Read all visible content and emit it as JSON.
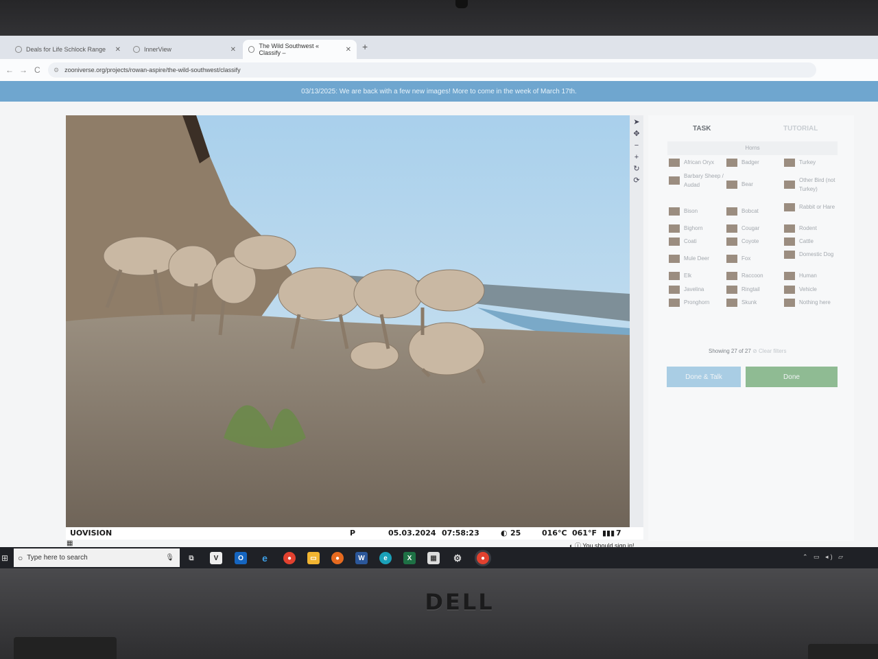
{
  "browser": {
    "tabs": [
      {
        "label": "Deals for Life Schlock Range"
      },
      {
        "label": "InnerView"
      },
      {
        "label": "The Wild Southwest « Classify –"
      }
    ],
    "new_tab": "+",
    "url": "zooniverse.org/projects/rowan-aspire/the-wild-southwest/classify",
    "back": "←",
    "forward": "→",
    "reload": "C"
  },
  "banner": {
    "text": "03/13/2025: We are back with a few new images! More to come in the week of March 17th."
  },
  "subject": {
    "camera_brand": "UOVISION",
    "mode": "P",
    "date": "05.03.2024",
    "time": "07:58:23",
    "moon_value": "25",
    "temp_c": "016°C",
    "temp_f": "061°F",
    "battery": "7"
  },
  "tools": [
    "➤",
    "✥",
    "−",
    "+",
    "↻",
    "⟳"
  ],
  "panel": {
    "tab_task": "TASK",
    "tab_tutorial": "TUTORIAL",
    "filters_label": "Horns",
    "choices": [
      [
        "African Oryx",
        "Badger",
        "Turkey"
      ],
      [
        "Barbary Sheep / Audad",
        "Bear",
        "Other Bird (not Turkey)"
      ],
      [
        "Bison",
        "Bobcat",
        "Rabbit or Hare"
      ],
      [
        "Bighorn",
        "Cougar",
        "Rodent"
      ],
      [
        "Coati",
        "Coyote",
        "Cattle"
      ],
      [
        "Mule Deer",
        "Fox",
        "Domestic Dog"
      ],
      [
        "Elk",
        "Raccoon",
        "Human"
      ],
      [
        "Javelina",
        "Ringtail",
        "Vehicle"
      ],
      [
        "Pronghorn",
        "Skunk",
        "Nothing here"
      ]
    ],
    "showing": "Showing 27 of 27",
    "clear_filters": "⊘ Clear filters",
    "done_talk": "Done & Talk",
    "done": "Done"
  },
  "footer": {
    "signin": "You should sign in!"
  },
  "taskbar": {
    "search_placeholder": "Type here to search",
    "icons": [
      "task-view",
      "vectorworks",
      "outlook",
      "edge-legacy",
      "chrome",
      "file-explorer",
      "firefox",
      "word",
      "edge",
      "excel",
      "app",
      "settings",
      "chrome-active"
    ],
    "tray": "⌃ ▭ ◂) ▱"
  },
  "laptop": {
    "brand": "DELL"
  }
}
